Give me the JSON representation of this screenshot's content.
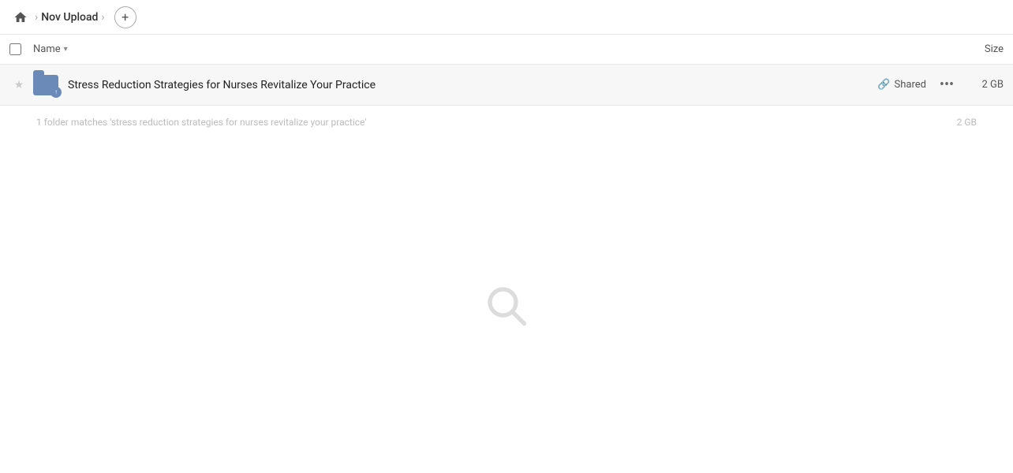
{
  "breadcrumb": {
    "home_icon": "home",
    "separator": "›",
    "current_folder": "Nov Upload",
    "add_button_label": "+"
  },
  "column_headers": {
    "name_label": "Name",
    "name_sort_icon": "▾",
    "size_label": "Size"
  },
  "file_row": {
    "star_icon": "★",
    "folder_icon": "folder-upload",
    "file_name": "Stress Reduction Strategies for Nurses Revitalize Your Practice",
    "shared_label": "Shared",
    "link_icon": "🔗",
    "more_options_icon": "···",
    "file_size": "2 GB"
  },
  "match_info": {
    "text": "1 folder matches 'stress reduction strategies for nurses revitalize your practice'",
    "size": "2 GB"
  },
  "colors": {
    "folder_blue": "#6b8ab8",
    "shared_text": "#555",
    "match_text": "#bbb",
    "row_bg": "#f7f7f7"
  }
}
